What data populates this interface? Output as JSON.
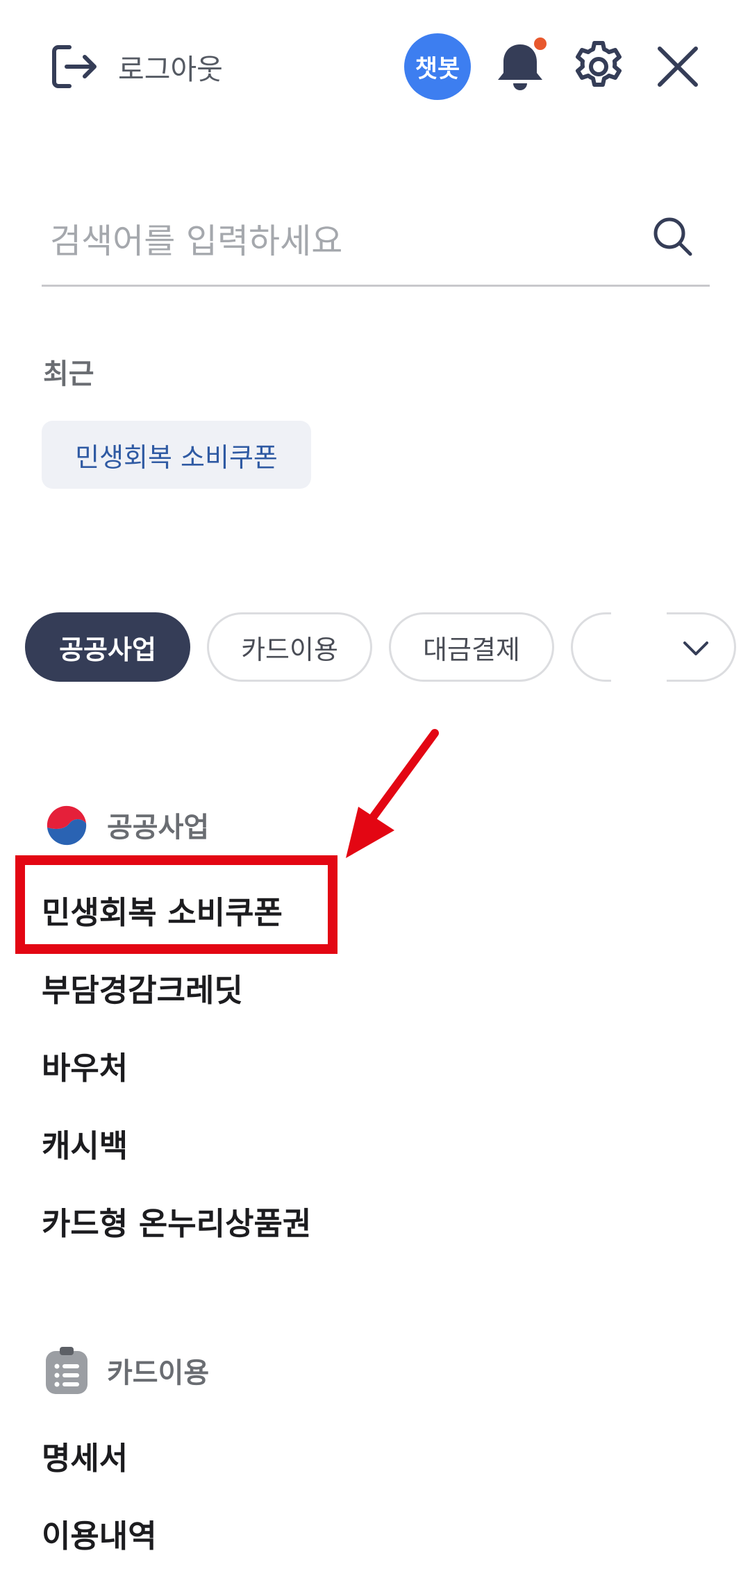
{
  "header": {
    "logout_label": "로그아웃",
    "chatbot_label": "챗봇",
    "icons": [
      "logout-icon",
      "bell-icon",
      "gear-icon",
      "close-icon"
    ],
    "notification_dot_color": "#e8582d",
    "chatbot_color": "#3d7ef0"
  },
  "search": {
    "placeholder": "검색어를 입력하세요",
    "value": ""
  },
  "recent": {
    "title": "최근",
    "items": [
      "민생회복 소비쿠폰"
    ]
  },
  "categories": {
    "tabs": [
      "공공사업",
      "카드이용",
      "대금결제"
    ],
    "selected": "공공사업",
    "active_color": "#353d57"
  },
  "sections": [
    {
      "title": "공공사업",
      "icon": "korea-government-emblem-icon",
      "items": [
        "민생회복 소비쿠폰",
        "부담경감크레딧",
        "바우처",
        "캐시백",
        "카드형 온누리상품권"
      ]
    },
    {
      "title": "카드이용",
      "icon": "clipboard-list-icon",
      "items": [
        "명세서",
        "이용내역"
      ]
    }
  ],
  "annotation": {
    "highlight_color": "#e30613",
    "highlighted_item": "민생회복 소비쿠폰"
  }
}
